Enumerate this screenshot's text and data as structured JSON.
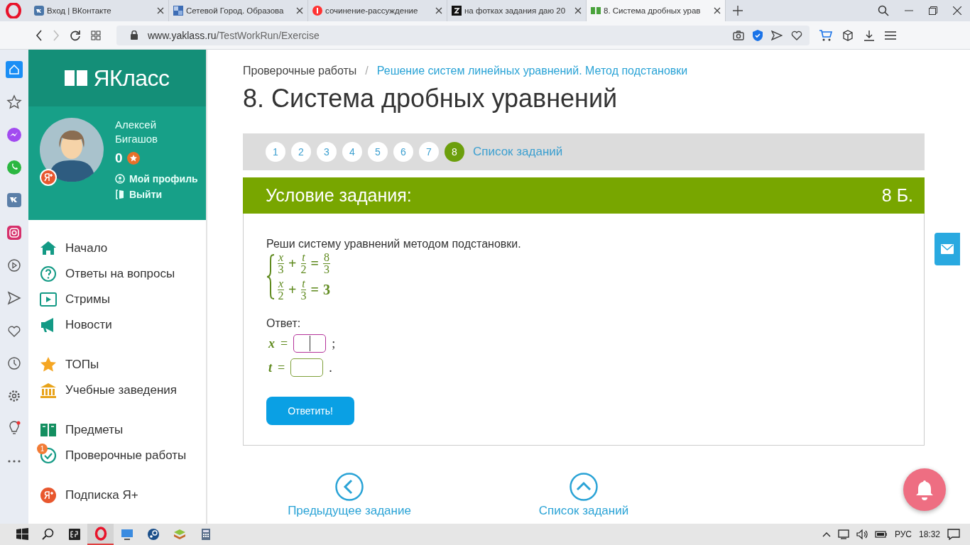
{
  "browser": {
    "tabs": [
      {
        "title": "Вход | ВКонтакте",
        "selected": false
      },
      {
        "title": "Сетевой Город. Образова",
        "selected": false
      },
      {
        "title": "сочинение-рассуждение",
        "selected": false
      },
      {
        "title": "на фотках задания даю 20",
        "selected": false
      },
      {
        "title": "8. Система дробных урав",
        "selected": true
      }
    ],
    "url_host": "www.yaklass.ru",
    "url_path": "/TestWorkRun/Exercise"
  },
  "site": {
    "logo": "ЯКласс",
    "user": {
      "first_name": "Алексей",
      "last_name": "Бигашов",
      "points": "0",
      "links": [
        "Мой профиль",
        "Выйти"
      ]
    },
    "nav": [
      [
        {
          "label": "Начало"
        },
        {
          "label": "Ответы на вопросы"
        },
        {
          "label": "Стримы"
        },
        {
          "label": "Новости"
        }
      ],
      [
        {
          "label": "ТОПы"
        },
        {
          "label": "Учебные заведения"
        }
      ],
      [
        {
          "label": "Предметы"
        },
        {
          "label": "Проверочные работы",
          "badge": "1"
        }
      ],
      [
        {
          "label": "Подписка Я+"
        }
      ]
    ]
  },
  "breadcrumb": {
    "root": "Проверочные работы",
    "separator": "/",
    "current": "Решение систем линейных уравнений. Метод подстановки"
  },
  "title": "8. Система дробных уравнений",
  "task_nav": {
    "numbers": [
      {
        "label": "1",
        "selected": false
      },
      {
        "label": "2",
        "selected": false
      },
      {
        "label": "3",
        "selected": false
      },
      {
        "label": "4",
        "selected": false
      },
      {
        "label": "5",
        "selected": false
      },
      {
        "label": "6",
        "selected": false
      },
      {
        "label": "7",
        "selected": false
      },
      {
        "label": "8",
        "selected": true
      }
    ],
    "list_link": "Список заданий"
  },
  "task": {
    "header": "Условие задания:",
    "points": "8 Б.",
    "prompt": "Реши систему уравнений методом подстановки.",
    "system": [
      [
        {
          "kind": "frac",
          "num": "x",
          "den": "3"
        },
        {
          "kind": "op",
          "text": "+"
        },
        {
          "kind": "frac",
          "num": "t",
          "den": "2"
        },
        {
          "kind": "op",
          "text": "="
        },
        {
          "kind": "frac",
          "num": "8",
          "den": "3"
        }
      ],
      [
        {
          "kind": "frac",
          "num": "x",
          "den": "2"
        },
        {
          "kind": "op",
          "text": "+"
        },
        {
          "kind": "frac",
          "num": "t",
          "den": "3"
        },
        {
          "kind": "op",
          "text": "="
        },
        {
          "kind": "num",
          "text": "3"
        }
      ]
    ],
    "answer_label": "Ответ:",
    "answers": [
      {
        "variable": "x",
        "sign": "=",
        "focused": true,
        "end": ";"
      },
      {
        "variable": "t",
        "sign": "=",
        "focused": false,
        "end": "."
      }
    ],
    "submit": "Ответить!"
  },
  "bottom_nav": [
    "Предыдущее задание",
    "Список заданий"
  ],
  "taskbar": {
    "language": "РУС",
    "time": "18:32"
  }
}
